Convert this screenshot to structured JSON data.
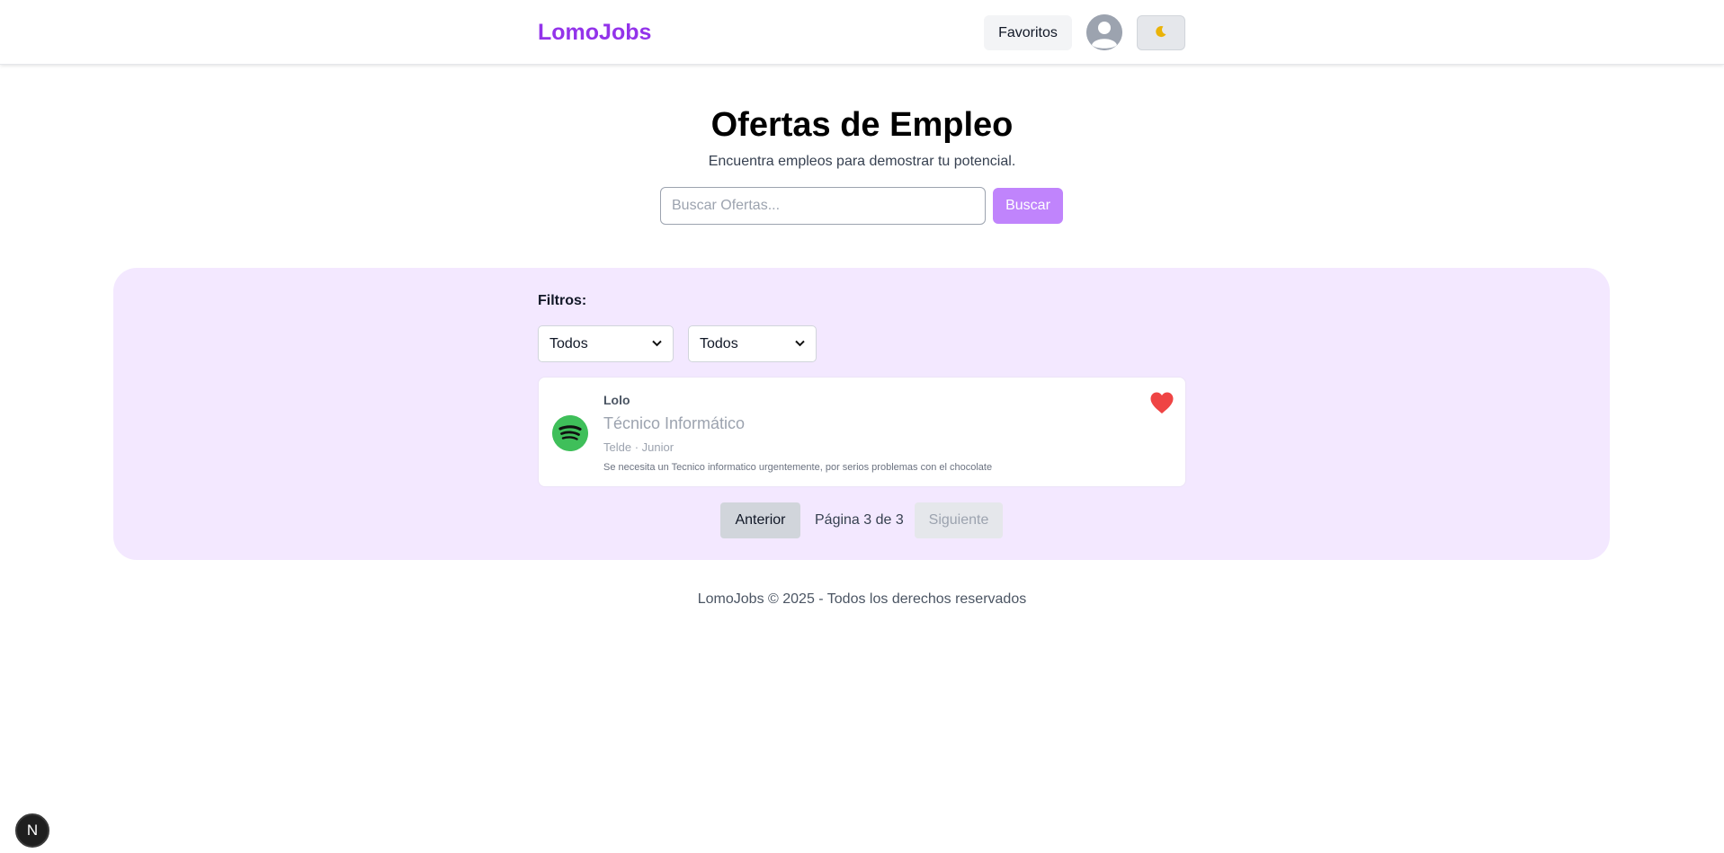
{
  "header": {
    "logo": "LomoJobs",
    "favorites_label": "Favoritos",
    "theme_toggle_icon": "moon-icon",
    "avatar_icon": "user-avatar-icon"
  },
  "hero": {
    "title": "Ofertas de Empleo",
    "subtitle": "Encuentra empleos para demostrar tu potencial.",
    "search_placeholder": "Buscar Ofertas...",
    "search_value": "",
    "search_button": "Buscar"
  },
  "filters": {
    "label": "Filtros:",
    "select_1_value": "Todos",
    "select_2_value": "Todos"
  },
  "jobs": [
    {
      "company": "Lolo",
      "title": "Técnico Informático",
      "meta": "Telde · Junior",
      "description": "Se necesita un Tecnico informatico urgentemente, por serios problemas con el chocolate",
      "favorite": true,
      "logo_icon": "spotify-logo-icon"
    }
  ],
  "pagination": {
    "prev_label": "Anterior",
    "page_info": "Página 3 de 3",
    "next_label": "Siguiente"
  },
  "footer": {
    "text": "LomoJobs © 2025 - Todos los derechos reservados"
  },
  "badge": {
    "label": "N"
  },
  "colors": {
    "brand": "#9333ea",
    "search_button": "#c084fc",
    "panel_bg": "#f3e8ff",
    "heart": "#ef4444"
  }
}
